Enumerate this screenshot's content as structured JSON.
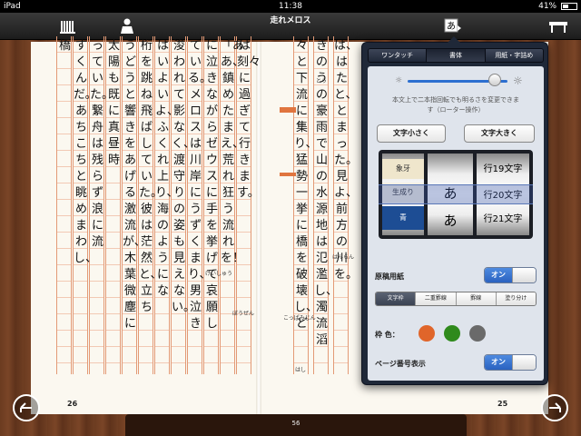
{
  "status": {
    "device": "iPad",
    "time": "11:38",
    "battery": "41%"
  },
  "toolbar": {
    "title": "走れメロス",
    "library_icon": "bookshelf-icon",
    "user_icon": "person-icon",
    "font_icon": "font-settings-icon",
    "font_icon_glyph": "あ",
    "menu_icon": "table-icon"
  },
  "left_page": {
    "number": "26",
    "columns": [
      "は刻々に過ぎて行きます。",
      "「ああ、鎮めたまえ、荒れ狂う流れを！",
      "に泣きながらゼウスに手を挙げて哀願し",
      "ている。メロスは川岸にうずくまり、男泣き",
      "浚われて影なく、渡守りの姿も見えない。",
      "はいよいよ、ふくれ上り、海のようにな",
      "桁を跳ね飛ばしていた。彼は茫然と、立ち",
      "うどうと響きをあげる激流が、木葉微塵に",
      "太陽も既に真昼時",
      "っていた。繋舟は残らず浪に流",
      "すくんだ。あちこちと眺めまわし、",
      "橋"
    ]
  },
  "right_page": {
    "number": "25",
    "columns": [
      "は、はたと、とまった。見よ、前方の川を。",
      "きのうの豪雨で山の水源地は氾濫し、濁流滔",
      "々と下流に集り、猛勢一挙に橋を破壊し、ど"
    ]
  },
  "ruby": [
    "とう",
    "はんらん",
    "こっぱみじん",
    "はし",
    "ぼうぜん",
    "けいしゅう"
  ],
  "bottom": {
    "page_indicator": "56"
  },
  "popover": {
    "tabs": [
      "ワンタッチ",
      "書体",
      "用紙・字詰め"
    ],
    "active_tab": 1,
    "brightness": {
      "value": 0.9,
      "hint": "本文上で二本指回転でも明るさを変更できます（ローター操作）"
    },
    "font_small": "文字小さく",
    "font_large": "文字大きく",
    "picker": {
      "colors": [
        "象牙",
        "生成り",
        "青"
      ],
      "glyph": [
        "あ",
        "あ",
        "あ"
      ],
      "lines": [
        "行19文字",
        "行20文字",
        "行21文字"
      ],
      "selected": 1
    },
    "manuscript_label": "原稿用紙",
    "manuscript_toggle": "オン",
    "styles": [
      "文字枠",
      "二重罫線",
      "罫線",
      "塗り分け"
    ],
    "active_style": 0,
    "frame_color_label": "枠 色：",
    "frame_colors": [
      "#e0652a",
      "#2f8a1c",
      "#6a6a6a"
    ],
    "page_number_label": "ページ番号表示",
    "page_number_toggle": "オン"
  }
}
